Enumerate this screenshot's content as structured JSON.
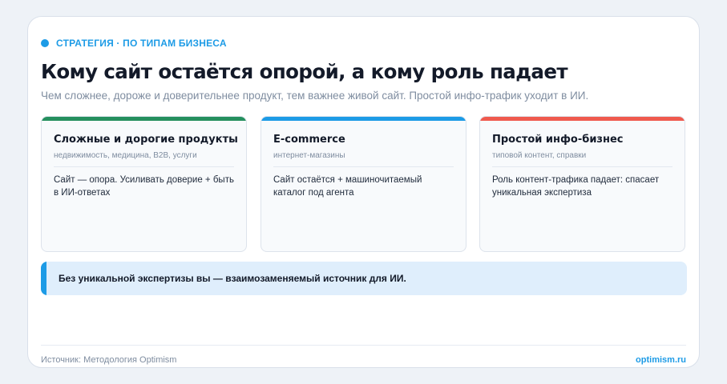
{
  "eyebrow": {
    "label": "СТРАТЕГИЯ · ПО ТИПАМ БИЗНЕСА"
  },
  "heading": {
    "title": "Кому сайт остаётся опорой, а кому роль падает",
    "subtitle": "Чем сложнее, дороже и доверительнее продукт, тем важнее живой сайт. Простой инфо-трафик уходит в ИИ."
  },
  "cards": [
    {
      "title": "Сложные и дорогие продукты",
      "meta": "недвижимость, медицина, B2B, услуги",
      "text": "Сайт — опора. Усиливать доверие + быть в ИИ-ответах",
      "accent": "#25905e"
    },
    {
      "title": "E-commerce",
      "meta": "интернет-магазины",
      "text": "Сайт остаётся + машиночитаемый каталог под агента",
      "accent": "#1d9be6"
    },
    {
      "title": "Простой инфо-бизнес",
      "meta": "типовой контент, справки",
      "text": "Роль контент-трафика падает: спасает уникальная экспертиза",
      "accent": "#ef5a4e"
    }
  ],
  "callout": {
    "text": "Без уникальной экспертизы вы — взаимозаменяемый источник для ИИ."
  },
  "footer": {
    "source": "Источник: Методология Optimism",
    "brand": "optimism.ru"
  },
  "colors": {
    "accent": "#1d9be6",
    "green": "#25905e",
    "red": "#ef5a4e"
  }
}
